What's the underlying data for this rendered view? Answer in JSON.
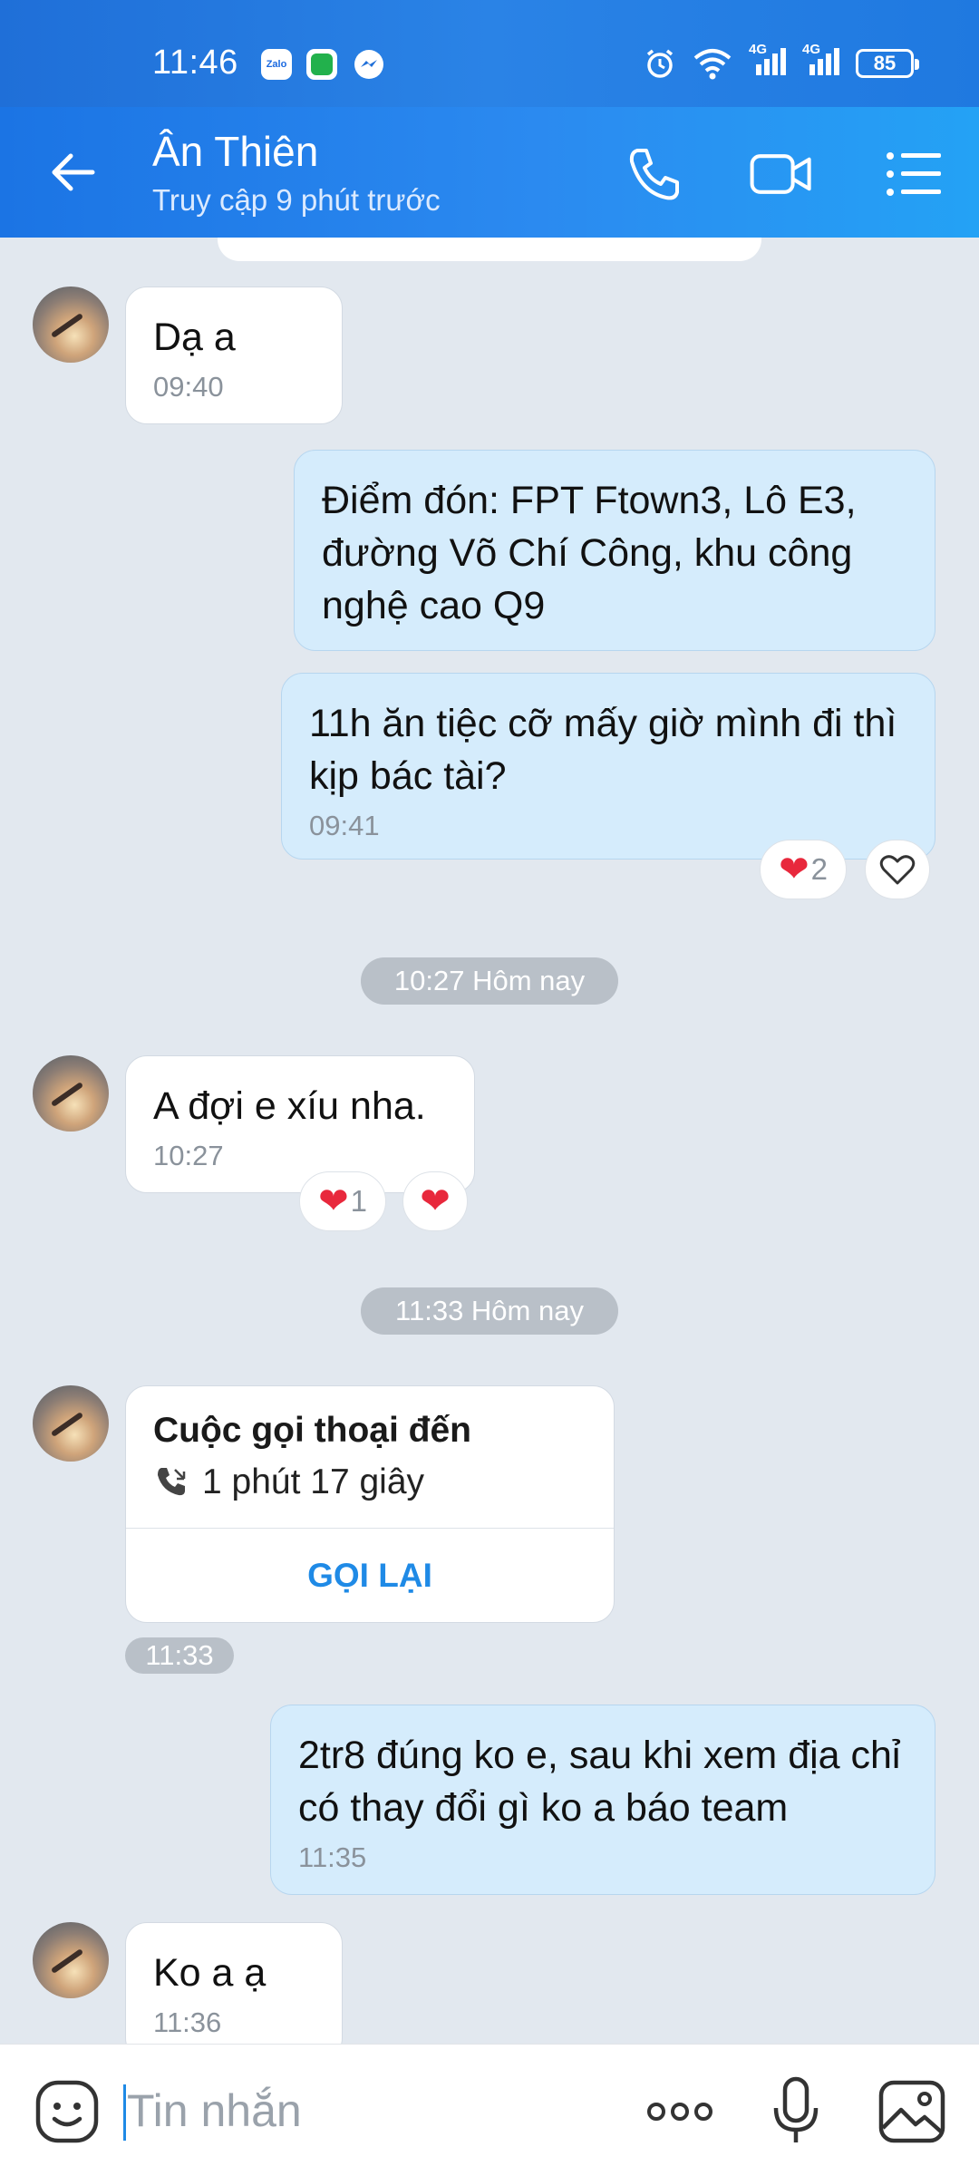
{
  "status_bar": {
    "time": "11:46",
    "app_icons": [
      "zalo-icon",
      "messaging-icon",
      "messenger-icon"
    ],
    "zalo_label": "Zalo",
    "network_1": "4G",
    "network_2": "4G",
    "battery": "85"
  },
  "header": {
    "name": "Ân Thiên",
    "status": "Truy cập 9 phút trước"
  },
  "messages": {
    "m1": {
      "text": "Dạ a",
      "time": "09:40"
    },
    "m2": {
      "text": "Điểm đón: FPT Ftown3, Lô E3, đường Võ Chí Công, khu công nghệ cao Q9"
    },
    "m3": {
      "text": "11h ăn tiệc cỡ mấy giờ mình đi thì kịp bác tài?",
      "time": "09:41",
      "reaction_count": "2"
    },
    "divider1": "10:27 Hôm nay",
    "m4": {
      "text": "A đợi e xíu nha.",
      "time": "10:27",
      "reaction_count": "1"
    },
    "divider2": "11:33 Hôm nay",
    "call": {
      "title": "Cuộc gọi thoại đến",
      "duration": "1 phút 17 giây",
      "action": "GỌI LẠI",
      "time": "11:33"
    },
    "m5": {
      "text": "2tr8 đúng ko e, sau khi xem địa chỉ có thay đổi gì ko a báo team",
      "time": "11:35"
    },
    "m6": {
      "text": "Ko a ạ",
      "time": "11:36"
    }
  },
  "input": {
    "placeholder": "Tin nhắn"
  },
  "colors": {
    "header_start": "#1b74e4",
    "header_end": "#24a2f5",
    "chat_bg": "#e2e8ef",
    "outgoing_bubble": "#d5ecfc",
    "accent": "#1f8ae6",
    "heart": "#e8283c"
  }
}
